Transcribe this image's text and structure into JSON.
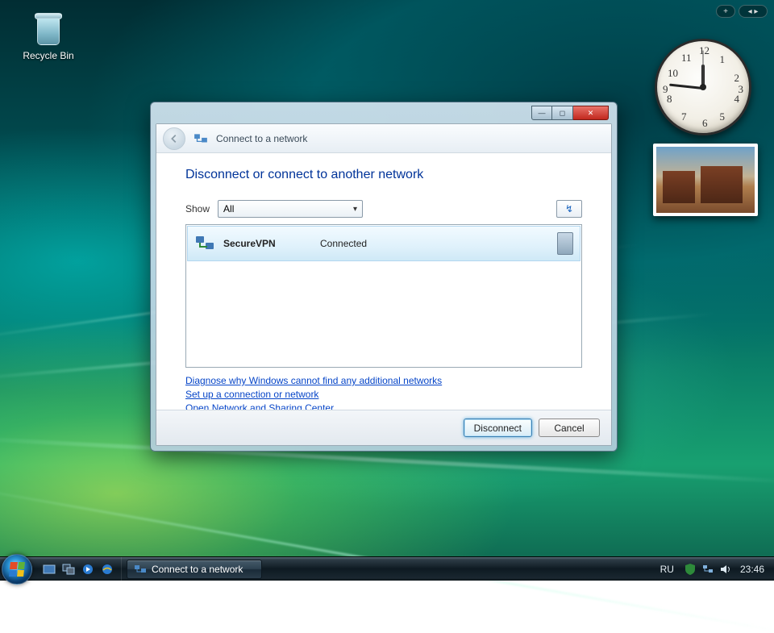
{
  "desktop": {
    "recycle_bin_label": "Recycle Bin"
  },
  "dialog": {
    "header_title": "Connect to a network",
    "heading": "Disconnect or connect to another network",
    "show_label": "Show",
    "show_value": "All",
    "network": {
      "name": "SecureVPN",
      "status": "Connected"
    },
    "links": {
      "diagnose": "Diagnose why Windows cannot find any additional networks",
      "setup": "Set up a connection or network",
      "sharing": "Open Network and Sharing Center"
    },
    "buttons": {
      "disconnect": "Disconnect",
      "cancel": "Cancel"
    }
  },
  "taskbar": {
    "task_label": "Connect to a network",
    "lang": "RU",
    "clock": "23:46"
  },
  "gadgets": {
    "clock": {
      "numbers": [
        "12",
        "1",
        "2",
        "3",
        "4",
        "5",
        "6",
        "7",
        "8",
        "9",
        "10",
        "11"
      ]
    }
  }
}
